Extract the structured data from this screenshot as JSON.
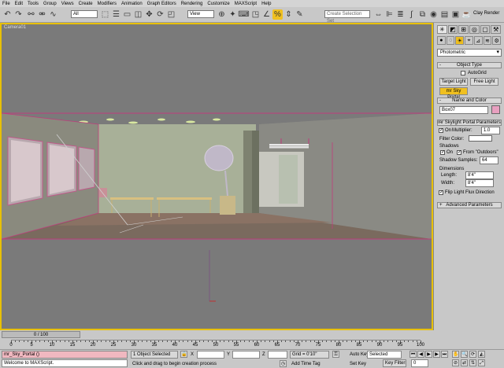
{
  "menu": [
    "File",
    "Edit",
    "Tools",
    "Group",
    "Views",
    "Create",
    "Modifiers",
    "Animation",
    "Graph Editors",
    "Rendering",
    "Customize",
    "MAXScript",
    "Help"
  ],
  "toolbar": {
    "selection_filter": "All",
    "ref_coord": "View",
    "named_selection_placeholder": "Create Selection Set",
    "clay_render": "Clay Render"
  },
  "viewport": {
    "label": "Camera01"
  },
  "command_panel": {
    "category": "Photometric",
    "object_type": {
      "title": "Object Type",
      "autogrid": "AutoGrid",
      "buttons": [
        "Target Light",
        "Free Light",
        "mr Sky Portal"
      ]
    },
    "name_color": {
      "title": "Name and Color",
      "name": "Box07",
      "color": "#e8a0c0"
    },
    "portal_params": {
      "title": "mr Skylight Portal Parameters",
      "on_label": "On",
      "multiplier_label": "Multiplier:",
      "multiplier": "1.0",
      "filter_color_label": "Filter Color:",
      "shadows_title": "Shadows",
      "shadows_on": "On",
      "from_outdoors": "From \"Outdoors\"",
      "shadow_samples_label": "Shadow Samples:",
      "shadow_samples": "64",
      "dimensions_title": "Dimensions",
      "length_label": "Length:",
      "length": "8'4\"",
      "width_label": "Width:",
      "width": "8'4\"",
      "flip_label": "Flip Light Flux Direction"
    },
    "advanced": "Advanced Parameters"
  },
  "timeline": {
    "slider": "0 / 100",
    "ticks": [
      "0",
      "5",
      "10",
      "15",
      "20",
      "25",
      "30",
      "35",
      "40",
      "45",
      "50",
      "55",
      "60",
      "65",
      "70",
      "75",
      "80",
      "85",
      "90",
      "95",
      "100"
    ]
  },
  "status": {
    "script_listener_top": "mr_Sky_Portal ()",
    "script_listener_bottom": "Welcome to MAXScript.",
    "selected": "1 Object Selected",
    "prompt": "Click and drag to begin creation process",
    "x_label": "X",
    "y_label": "Y",
    "z_label": "Z",
    "grid": "Grid = 0'10\"",
    "add_time_tag": "Add Time Tag",
    "auto_key": "Auto Key",
    "set_key": "Set Key",
    "key_selection": "Selected",
    "key_filters": "Key Filters...",
    "frame": "0"
  }
}
